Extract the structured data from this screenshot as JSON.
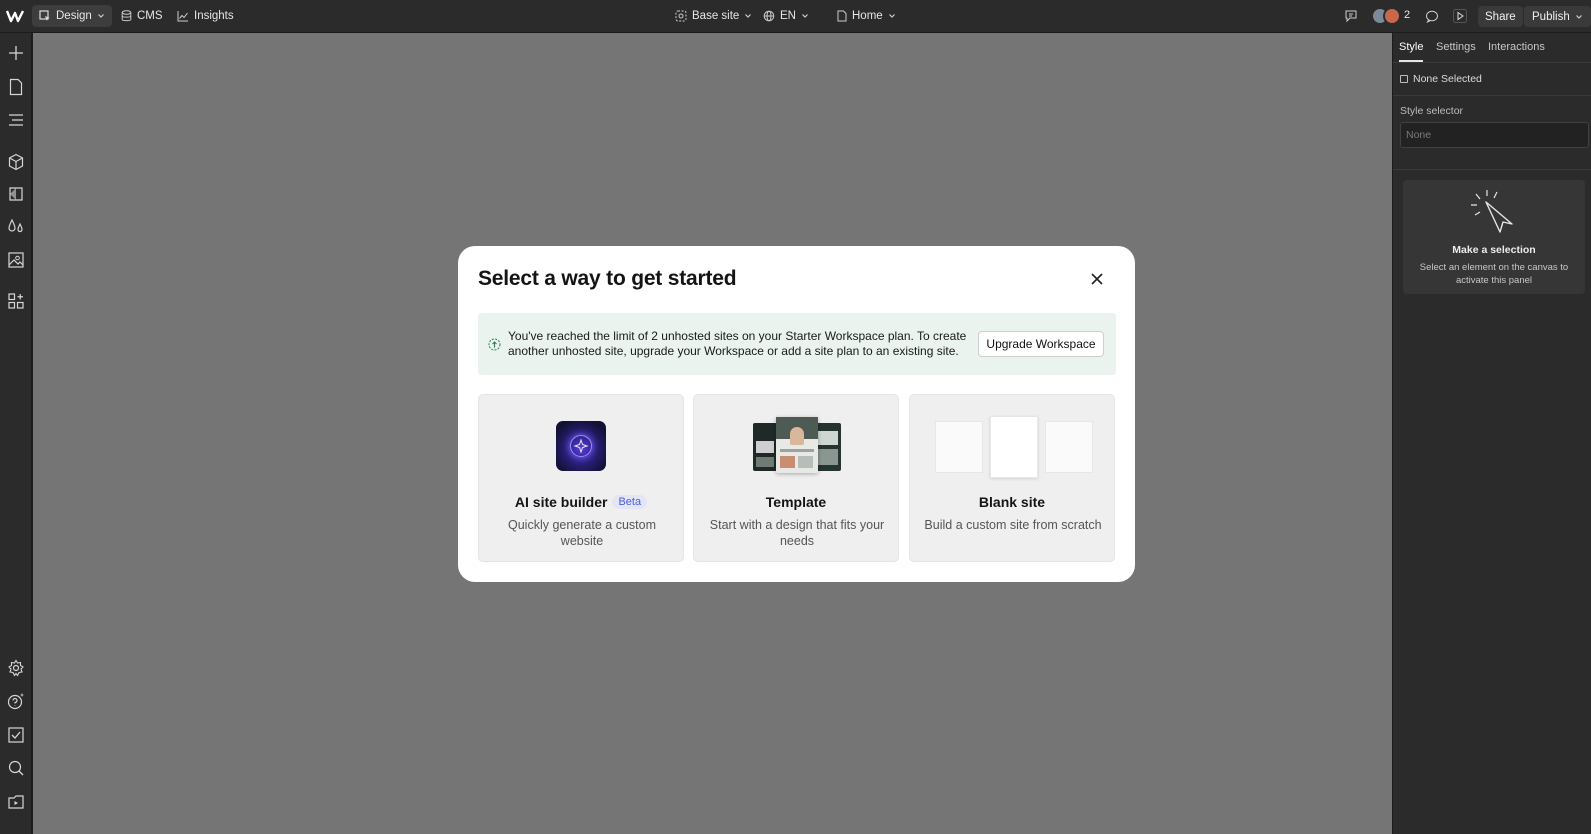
{
  "topbar": {
    "design_label": "Design",
    "cms_label": "CMS",
    "insights_label": "Insights",
    "site_label": "Base site",
    "locale_label": "EN",
    "page_label": "Home",
    "collaborator_count": "2",
    "share_label": "Share",
    "publish_label": "Publish"
  },
  "left_rail": {
    "icons": [
      "add-icon",
      "pages-icon",
      "navigator-icon",
      "components-icon",
      "variables-icon",
      "styles-icon",
      "assets-icon",
      "apps-icon",
      "settings-icon",
      "help-icon",
      "audit-icon",
      "search-icon",
      "video-icon"
    ]
  },
  "right_panel": {
    "tabs": [
      "Style",
      "Settings",
      "Interactions"
    ],
    "active_tab": "Style",
    "none_selected_label": "None Selected",
    "style_selector_label": "Style selector",
    "style_selector_placeholder": "None",
    "empty_title": "Make a selection",
    "empty_desc": "Select an element on the canvas to activate this panel"
  },
  "modal": {
    "title": "Select a way to get started",
    "alert_text": "You've reached the limit of 2 unhosted sites on your Starter Workspace plan. To create another unhosted site, upgrade your Workspace or add a site plan to an existing site.",
    "upgrade_label": "Upgrade Workspace",
    "options": [
      {
        "title": "AI site builder",
        "badge": "Beta",
        "desc": "Quickly generate a custom website"
      },
      {
        "title": "Template",
        "desc": "Start with a design that fits your needs"
      },
      {
        "title": "Blank site",
        "desc": "Build a custom site from scratch"
      }
    ]
  },
  "colors": {
    "chrome": "#2b2b2b",
    "canvas": "#757575",
    "alert_bg": "#eaf3ee",
    "beta_text": "#4a5fd6"
  }
}
